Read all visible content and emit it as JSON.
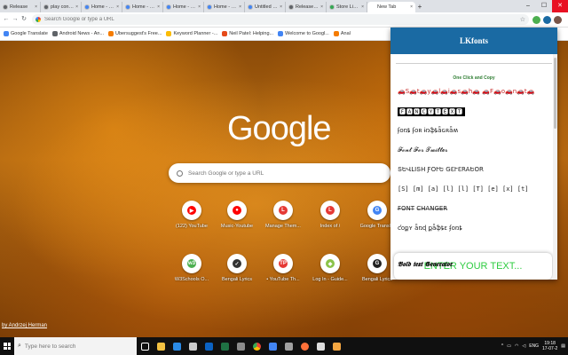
{
  "tabs": [
    {
      "label": "Release",
      "fav_color": "#5f6368",
      "active": false
    },
    {
      "label": "play console",
      "fav_color": "#5f6368",
      "active": false
    },
    {
      "label": "Home - Co",
      "fav_color": "#4285f4",
      "active": false
    },
    {
      "label": "Home - Co",
      "fav_color": "#4285f4",
      "active": false
    },
    {
      "label": "Home - Co",
      "fav_color": "#4285f4",
      "active": false
    },
    {
      "label": "Home - Co",
      "fav_color": "#4285f4",
      "active": false
    },
    {
      "label": "Untitled do",
      "fav_color": "#4285f4",
      "active": false
    },
    {
      "label": "Release No",
      "fav_color": "#5f6368",
      "active": false
    },
    {
      "label": "Store Listing",
      "fav_color": "#34a853",
      "active": false
    },
    {
      "label": "New Tab",
      "fav_color": "#ffffff",
      "active": true
    }
  ],
  "omnibox": {
    "placeholder": "Search Google or type a URL"
  },
  "bookmarks": [
    {
      "label": "Google Translate",
      "color": "#4285f4"
    },
    {
      "label": "Android News - An...",
      "color": "#5f6368"
    },
    {
      "label": "Ubersuggest's Free...",
      "color": "#f57c00"
    },
    {
      "label": "Keyword Planner -...",
      "color": "#fbbc05"
    },
    {
      "label": "Neil Patel: Helping...",
      "color": "#e64a19"
    },
    {
      "label": "Welcome to Googl...",
      "color": "#4285f4"
    },
    {
      "label": "Anal",
      "color": "#f57c00"
    }
  ],
  "google": {
    "logo": "Google",
    "search_placeholder": "Search Google or type a URL",
    "photo_credit": "by Andrzej Herman"
  },
  "shortcuts": [
    {
      "label": "(122) YouTube",
      "color": "#ff0000",
      "glyph": "▶"
    },
    {
      "label": "Music-Youtube",
      "color": "#ff0000",
      "glyph": "●"
    },
    {
      "label": "Manage Them...",
      "color": "#e53935",
      "glyph": "L"
    },
    {
      "label": "Index of /",
      "color": "#e53935",
      "glyph": "L"
    },
    {
      "label": "Google Transl...",
      "color": "#4285f4",
      "glyph": "G"
    },
    {
      "label": "W3Schools O...",
      "color": "#4caf50",
      "glyph": "w3"
    },
    {
      "label": "Bengali Lyrics",
      "color": "#333333",
      "glyph": "✓"
    },
    {
      "label": "• YouTube Th...",
      "color": "#e53935",
      "glyph": "TP"
    },
    {
      "label": "Log In - Guide...",
      "color": "#8bc34a",
      "glyph": "◆"
    },
    {
      "label": "Bengali Lyrics",
      "color": "#222222",
      "glyph": "G"
    }
  ],
  "popup": {
    "title": "LKfonts",
    "one_click": "One Click and Copy",
    "styles": [
      "🚗S🚗t🚗y🚗l🚗i🚗s🚗h🚗 🚗F🚗o🚗n🚗t🚗",
      "🅵🅰🅽🅲🆈🆃🅴🆇🆃",
      "ʄօռȶ ʄօʀ ɨռֆȶǟɢʀǟʍ",
      "𝓕𝓸𝓷𝓽 𝓕𝓸𝓻 𝓣𝔀𝓲𝓽𝓽𝓮𝓻",
      "ՏԵՎԼIՏH ƑՕՒԵ GƐՒƐRAԵՕR",
      "[S] [m] [a] [l] [l] [T] [e] [x] [t]",
      "F̶O̶N̶T̶ C̶H̶A̶N̶G̶E̶R̶",
      "ƈօքʏ ǟռɖ քǟֆȶɛ ʄօռȶ"
    ],
    "enter_text": "ENTER YOUR TEXT...",
    "bold_generator": "𝕭𝖔𝖑𝖉 𝖙𝖊𝖝𝖙 𝕲𝖊𝖓𝖊𝖗𝖆𝖙𝖔𝖗"
  },
  "taskbar": {
    "search_placeholder": "Type here to search",
    "lang": "ENG",
    "time": "19:18",
    "date": "17-07-2"
  }
}
